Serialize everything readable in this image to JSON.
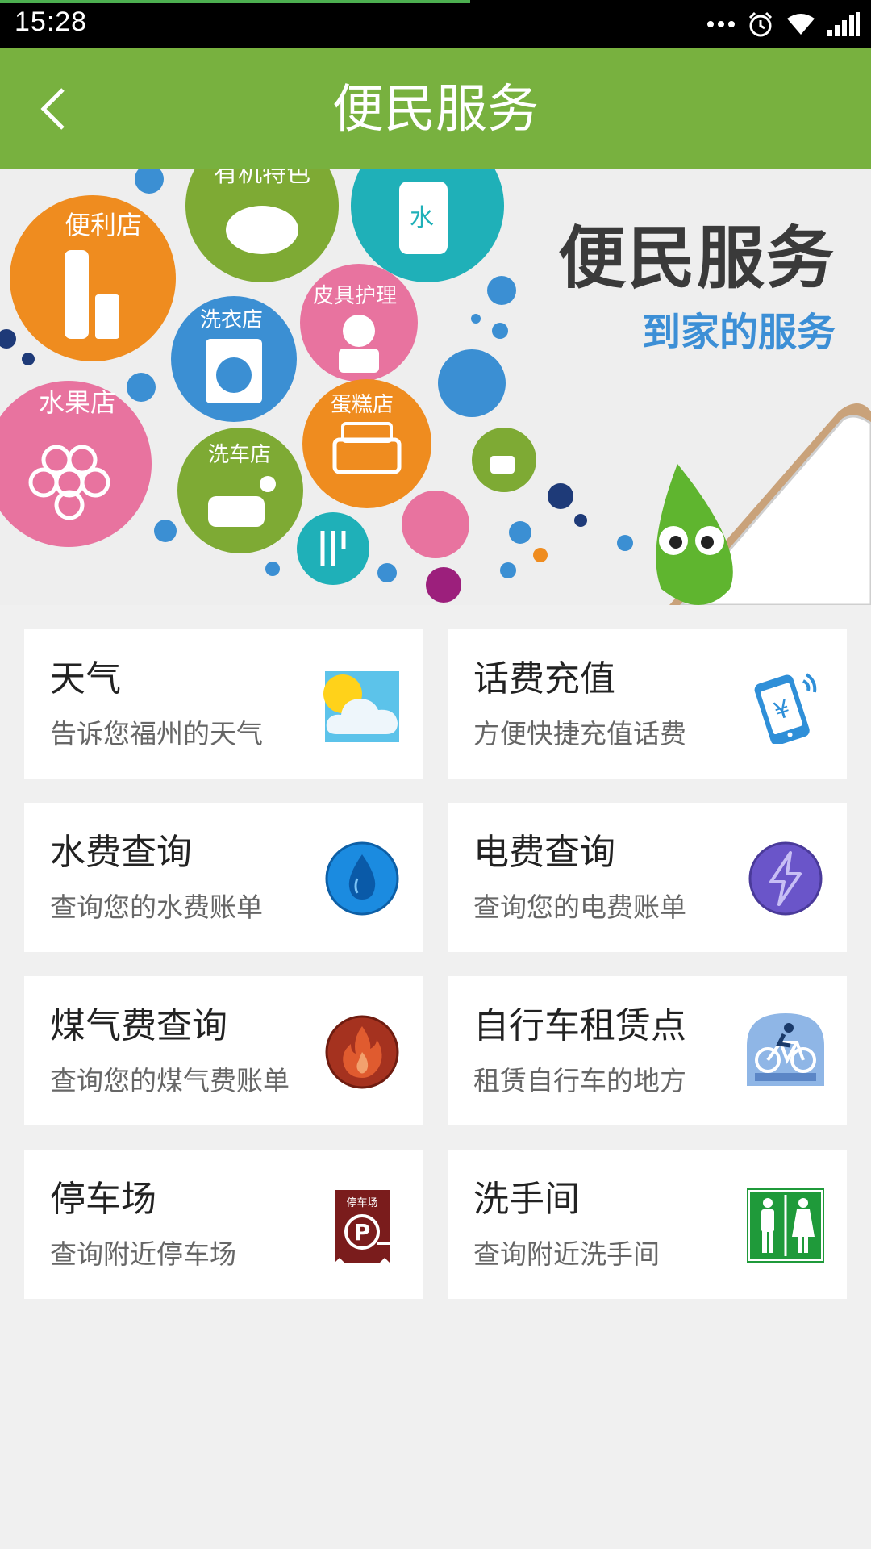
{
  "status_bar": {
    "time": "15:28",
    "load_progress": 0.54,
    "icons": [
      "more-dots-icon",
      "alarm-icon",
      "wifi-icon",
      "signal-icon"
    ]
  },
  "title_bar": {
    "title": "便民服务",
    "back_icon": "back-chevron-icon",
    "color": "#78b13f"
  },
  "banner": {
    "title": "便民服务",
    "subtitle": "到家的服务",
    "bubbles": [
      "便利店",
      "有机特色",
      "水",
      "皮具护理",
      "洗衣店",
      "水果店",
      "蛋糕店",
      "洗车店"
    ]
  },
  "services": [
    {
      "title": "天气",
      "desc": "告诉您福州的天气",
      "icon": "weather-icon"
    },
    {
      "title": "话费充值",
      "desc": "方便快捷充值话费",
      "icon": "phone-recharge-icon"
    },
    {
      "title": "水费查询",
      "desc": "查询您的水费账单",
      "icon": "water-drop-icon"
    },
    {
      "title": "电费查询",
      "desc": "查询您的电费账单",
      "icon": "lightning-icon"
    },
    {
      "title": "煤气费查询",
      "desc": "查询您的煤气费账单",
      "icon": "flame-icon"
    },
    {
      "title": "自行车租赁点",
      "desc": "租赁自行车的地方",
      "icon": "bicycle-icon"
    },
    {
      "title": "停车场",
      "desc": "查询附近停车场",
      "icon": "parking-icon",
      "icon_text": "停车场"
    },
    {
      "title": "洗手间",
      "desc": "查询附近洗手间",
      "icon": "restroom-icon"
    }
  ]
}
